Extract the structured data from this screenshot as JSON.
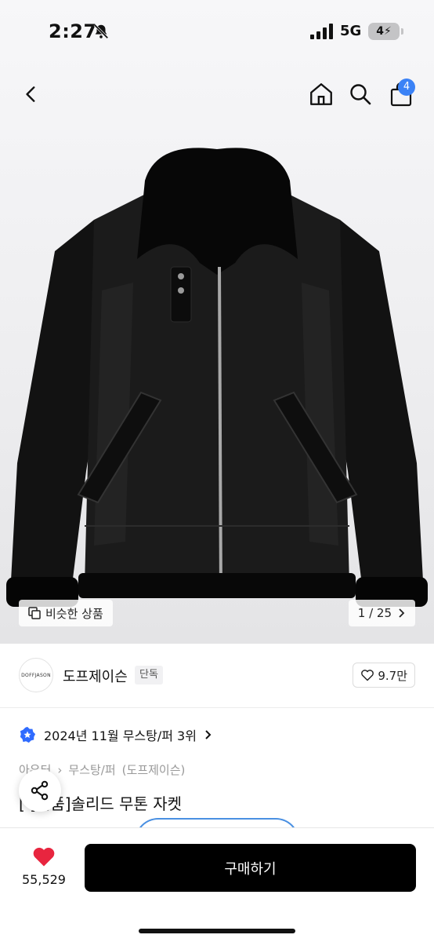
{
  "status_bar": {
    "time": "2:27",
    "network": "5G",
    "battery": "4"
  },
  "nav": {
    "cart_count": "4",
    "icons": [
      "chevron-left-icon",
      "home-icon",
      "search-icon",
      "shopping-bag-icon"
    ]
  },
  "gallery": {
    "similar_label": "비슷한 상품",
    "page_indicator": "1 / 25"
  },
  "brand": {
    "logo_text": "DOFFJASON",
    "name": "도프제이슨",
    "tag": "단독",
    "likes": "9.7만"
  },
  "product": {
    "ranking": "2024년 11월 무스탕/퍼 3위",
    "breadcrumb": [
      "아우터",
      "무스탕/퍼",
      "(도프제이슨)"
    ],
    "title": "[ ]반품]솔리드 무톤 자켓"
  },
  "purchase": {
    "heart_count": "55,529",
    "buy_label": "구매하기"
  },
  "colors": {
    "accent_blue": "#3b82f6",
    "heart_red": "#e8253f",
    "buy_button": "#000000"
  }
}
